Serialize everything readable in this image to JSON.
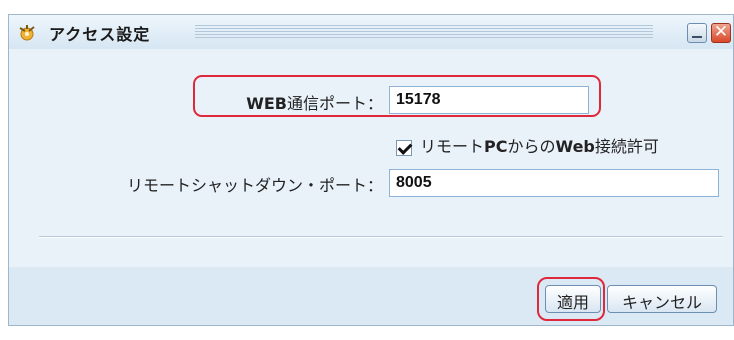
{
  "window": {
    "title": "アクセス設定",
    "close_glyph": "✕"
  },
  "form": {
    "web_port_label_prefix": "WEB",
    "web_port_label_suffix": "通信ポート：",
    "web_port_value": "15178",
    "remote_web_checkbox_checked": true,
    "remote_web_checkbox_label_1": "リモート",
    "remote_web_checkbox_label_2": "PC",
    "remote_web_checkbox_label_3": "からの",
    "remote_web_checkbox_label_4": "Web",
    "remote_web_checkbox_label_5": "接続許可",
    "shutdown_port_label": "リモートシャットダウン・ポート：",
    "shutdown_port_value": "8005"
  },
  "footer": {
    "apply_label": "適用",
    "cancel_label": "キャンセル"
  },
  "colors": {
    "window_bg": "#dbe9f5",
    "content_bg": "#e9f1f9",
    "highlight": "#e0283c",
    "close_button": "#d9482a"
  }
}
